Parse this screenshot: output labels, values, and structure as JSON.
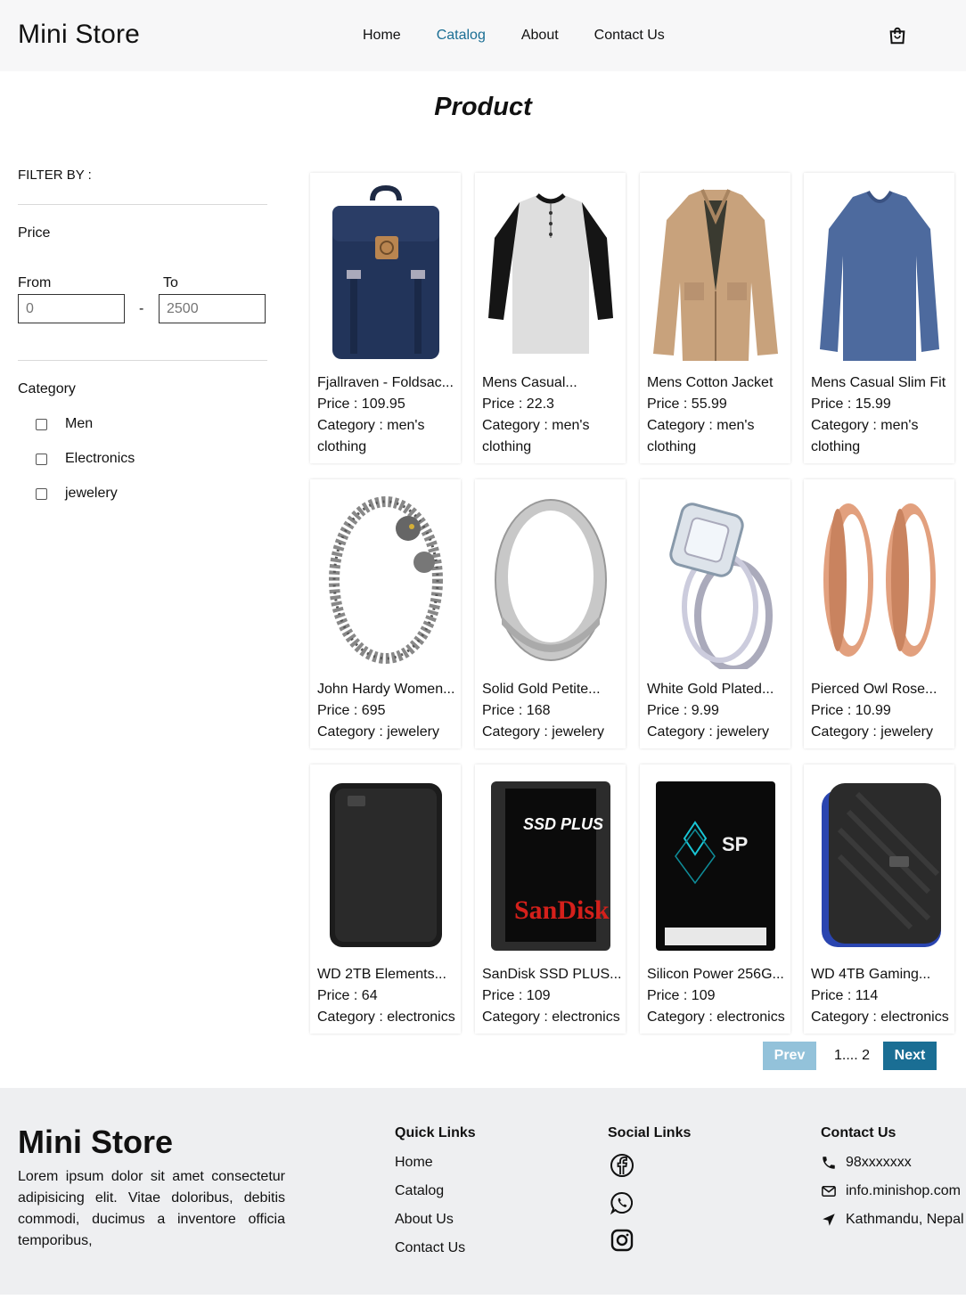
{
  "header": {
    "brand": "Mini Store",
    "nav": [
      "Home",
      "Catalog",
      "About",
      "Contact Us"
    ],
    "active_nav": "Catalog",
    "cart_icon": "shopping-bag-icon"
  },
  "page_title": "Product",
  "filter": {
    "title": "FILTER BY :",
    "price_label": "Price",
    "from_label": "From",
    "to_label": "To",
    "from_placeholder": "0",
    "to_placeholder": "2500",
    "dash": "-",
    "category_label": "Category",
    "categories": [
      "Men",
      "Electronics",
      "jewelery"
    ]
  },
  "products": [
    {
      "title": "Fjallraven - Foldsac...",
      "price": "Price : 109.95",
      "category": "Category : men's",
      "category2": "clothing"
    },
    {
      "title": "Mens Casual...",
      "price": "Price : 22.3",
      "category": "Category : men's",
      "category2": "clothing"
    },
    {
      "title": "Mens Cotton Jacket",
      "price": "Price : 55.99",
      "category": "Category : men's",
      "category2": "clothing"
    },
    {
      "title": "Mens Casual Slim Fit",
      "price": "Price : 15.99",
      "category": "Category : men's",
      "category2": "clothing"
    },
    {
      "title": "John Hardy Women...",
      "price": "Price : 695",
      "category": "Category : jewelery"
    },
    {
      "title": "Solid Gold Petite...",
      "price": "Price : 168",
      "category": "Category : jewelery"
    },
    {
      "title": "White Gold Plated...",
      "price": "Price : 9.99",
      "category": "Category : jewelery"
    },
    {
      "title": "Pierced Owl Rose...",
      "price": "Price : 10.99",
      "category": "Category : jewelery"
    },
    {
      "title": "WD 2TB Elements...",
      "price": "Price : 64",
      "category": "Category : electronics"
    },
    {
      "title": "SanDisk SSD PLUS...",
      "price": "Price : 109",
      "category": "Category : electronics"
    },
    {
      "title": "Silicon Power 256G...",
      "price": "Price : 109",
      "category": "Category : electronics"
    },
    {
      "title": "WD 4TB Gaming...",
      "price": "Price : 114",
      "category": "Category : electronics"
    }
  ],
  "pagination": {
    "prev": "Prev",
    "pages": "1.... 2",
    "next": "Next"
  },
  "footer": {
    "brand": "Mini Store",
    "description": "Lorem ipsum dolor sit amet consectetur adipisicing elit. Vitae doloribus, debitis commodi, ducimus a inventore officia temporibus,",
    "quick_links_title": "Quick Links",
    "quick_links": [
      "Home",
      "Catalog",
      "About Us",
      "Contact Us"
    ],
    "social_title": "Social Links",
    "social": [
      "facebook-icon",
      "whatsapp-icon",
      "instagram-icon"
    ],
    "contact_title": "Contact Us",
    "phone": "98xxxxxxx",
    "email": "info.minishop.com",
    "location": "Kathmandu, Nepal"
  },
  "colors": {
    "accent": "#1a6e94",
    "prev_disabled": "#93c2da",
    "header_bg": "#f7f7f8",
    "footer_bg": "#eeeff1"
  }
}
